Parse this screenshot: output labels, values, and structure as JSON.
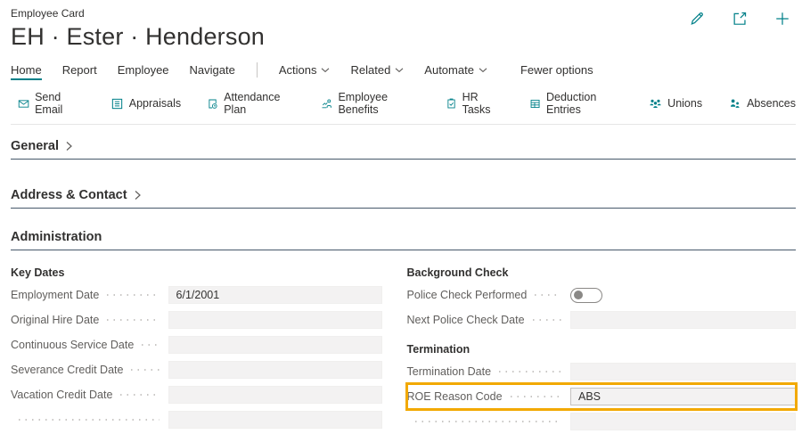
{
  "colors": {
    "accent": "#008089",
    "highlight_border": "#f2a900",
    "input_bg": "#f3f2f2",
    "section_rule": "#46586a",
    "toggle_off": "#8a8886"
  },
  "header": {
    "caption": "Employee Card",
    "title": "EH · Ester · Henderson",
    "icons": [
      "edit-icon",
      "share-icon",
      "add-icon"
    ]
  },
  "menu": {
    "items": [
      {
        "label": "Home",
        "active": true
      },
      {
        "label": "Report"
      },
      {
        "label": "Employee"
      },
      {
        "label": "Navigate"
      },
      {
        "label": "Actions",
        "dropdown": true
      },
      {
        "label": "Related",
        "dropdown": true
      },
      {
        "label": "Automate",
        "dropdown": true
      },
      {
        "label": "Fewer options"
      }
    ]
  },
  "action_bar": {
    "items": [
      {
        "icon": "send-email-icon",
        "label": "Send Email"
      },
      {
        "icon": "appraisals-icon",
        "label": "Appraisals"
      },
      {
        "icon": "attendance-plan-icon",
        "label": "Attendance Plan"
      },
      {
        "icon": "employee-benefits-icon",
        "label": "Employee Benefits"
      },
      {
        "icon": "hr-tasks-icon",
        "label": "HR Tasks"
      },
      {
        "icon": "deduction-entries-icon",
        "label": "Deduction Entries"
      },
      {
        "icon": "unions-icon",
        "label": "Unions"
      },
      {
        "icon": "absences-icon",
        "label": "Absences"
      }
    ]
  },
  "sections": {
    "general": {
      "title": "General",
      "collapsed": true
    },
    "address": {
      "title": "Address & Contact",
      "collapsed": true
    },
    "administration": {
      "title": "Administration",
      "collapsed": false
    }
  },
  "administration": {
    "key_dates": {
      "title": "Key Dates",
      "fields": [
        {
          "label": "Employment Date",
          "value": "6/1/2001"
        },
        {
          "label": "Original Hire Date",
          "value": ""
        },
        {
          "label": "Continuous Service Date",
          "value": ""
        },
        {
          "label": "Severance Credit Date",
          "value": ""
        },
        {
          "label": "Vacation Credit Date",
          "value": ""
        }
      ]
    },
    "background_check": {
      "title": "Background Check",
      "fields": [
        {
          "label": "Police Check Performed",
          "control": "toggle",
          "state": "off"
        },
        {
          "label": "Next Police Check Date",
          "value": ""
        }
      ]
    },
    "termination": {
      "title": "Termination",
      "fields": [
        {
          "label": "Termination Date",
          "value": ""
        },
        {
          "label": "ROE Reason Code",
          "value": "ABS",
          "highlighted": true
        }
      ]
    }
  }
}
